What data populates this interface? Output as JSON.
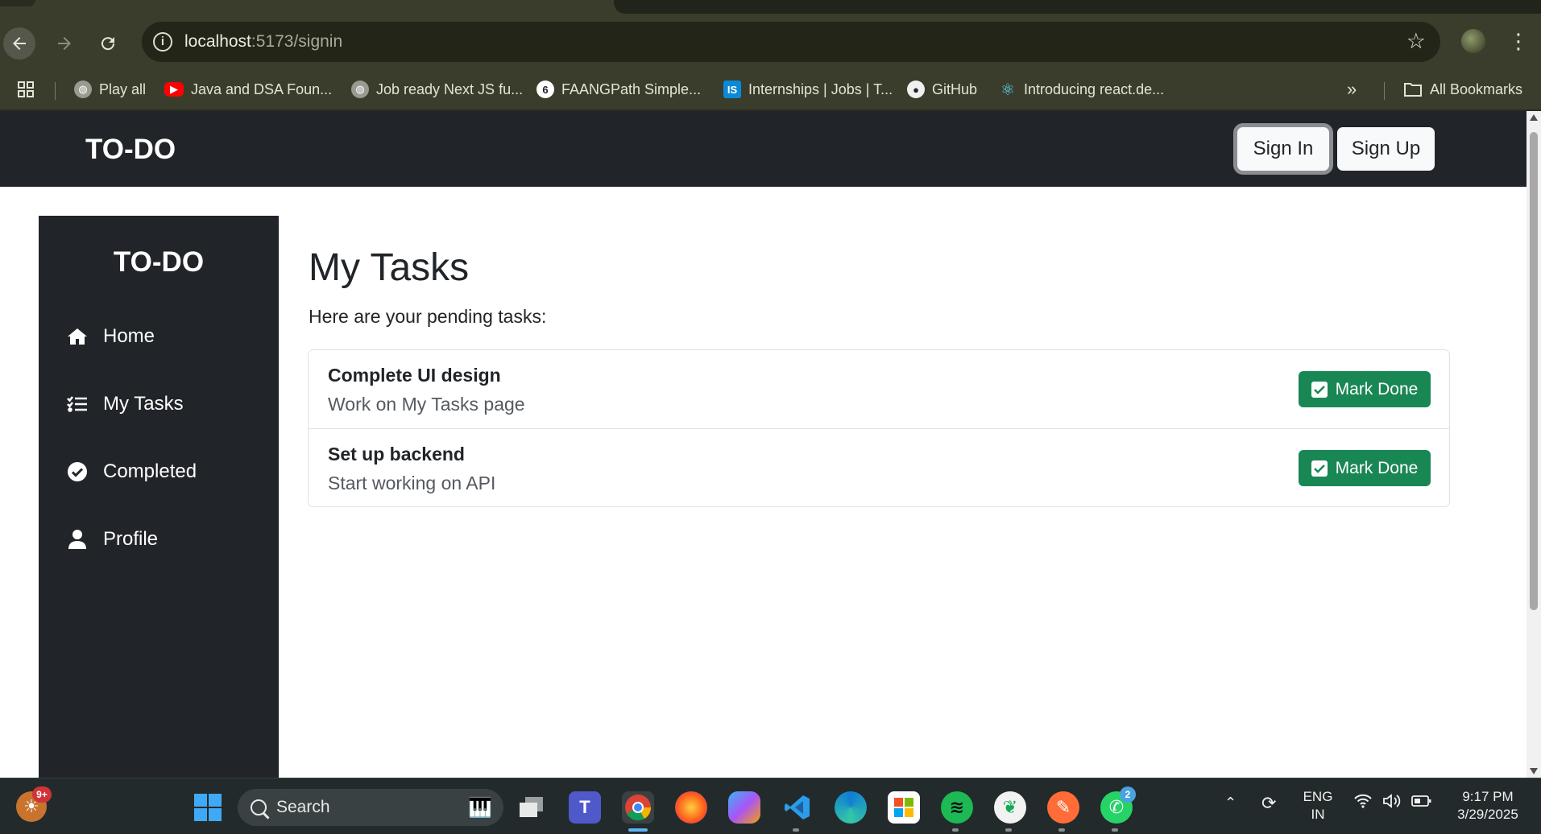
{
  "browser": {
    "url_host": "localhost",
    "url_path": ":5173/signin",
    "bookmarks": [
      {
        "label": "Play all",
        "icon": "globe-icon"
      },
      {
        "label": "Java and DSA Foun...",
        "icon": "youtube-icon"
      },
      {
        "label": "Job ready Next JS fu...",
        "icon": "globe-icon"
      },
      {
        "label": "FAANGPath Simple...",
        "icon": "faangpath-icon"
      },
      {
        "label": "Internships | Jobs | T...",
        "icon": "internshala-icon"
      },
      {
        "label": "GitHub",
        "icon": "github-icon"
      },
      {
        "label": "Introducing react.de...",
        "icon": "react-icon"
      }
    ],
    "overflow": "»",
    "all_bookmarks": "All Bookmarks"
  },
  "header": {
    "brand": "TO-DO",
    "signin_label": "Sign In",
    "signup_label": "Sign Up"
  },
  "sidebar": {
    "brand": "TO-DO",
    "items": [
      {
        "label": "Home",
        "icon": "home-icon"
      },
      {
        "label": "My Tasks",
        "icon": "list-check-icon"
      },
      {
        "label": "Completed",
        "icon": "check-circle-icon"
      },
      {
        "label": "Profile",
        "icon": "user-icon"
      }
    ]
  },
  "main": {
    "title": "My Tasks",
    "subtitle": "Here are your pending tasks:",
    "tasks": [
      {
        "title": "Complete UI design",
        "description": "Work on My Tasks page",
        "action": "Mark Done"
      },
      {
        "title": "Set up backend",
        "description": "Start working on API",
        "action": "Mark Done"
      }
    ]
  },
  "taskbar": {
    "weather_badge": "9+",
    "search_placeholder": "Search",
    "whatsapp_badge": "2",
    "language": "ENG",
    "region": "IN",
    "time": "9:17 PM",
    "date": "3/29/2025"
  },
  "colors": {
    "navbar": "#212529",
    "success": "#198754",
    "chrome": "#3b3d2c"
  }
}
